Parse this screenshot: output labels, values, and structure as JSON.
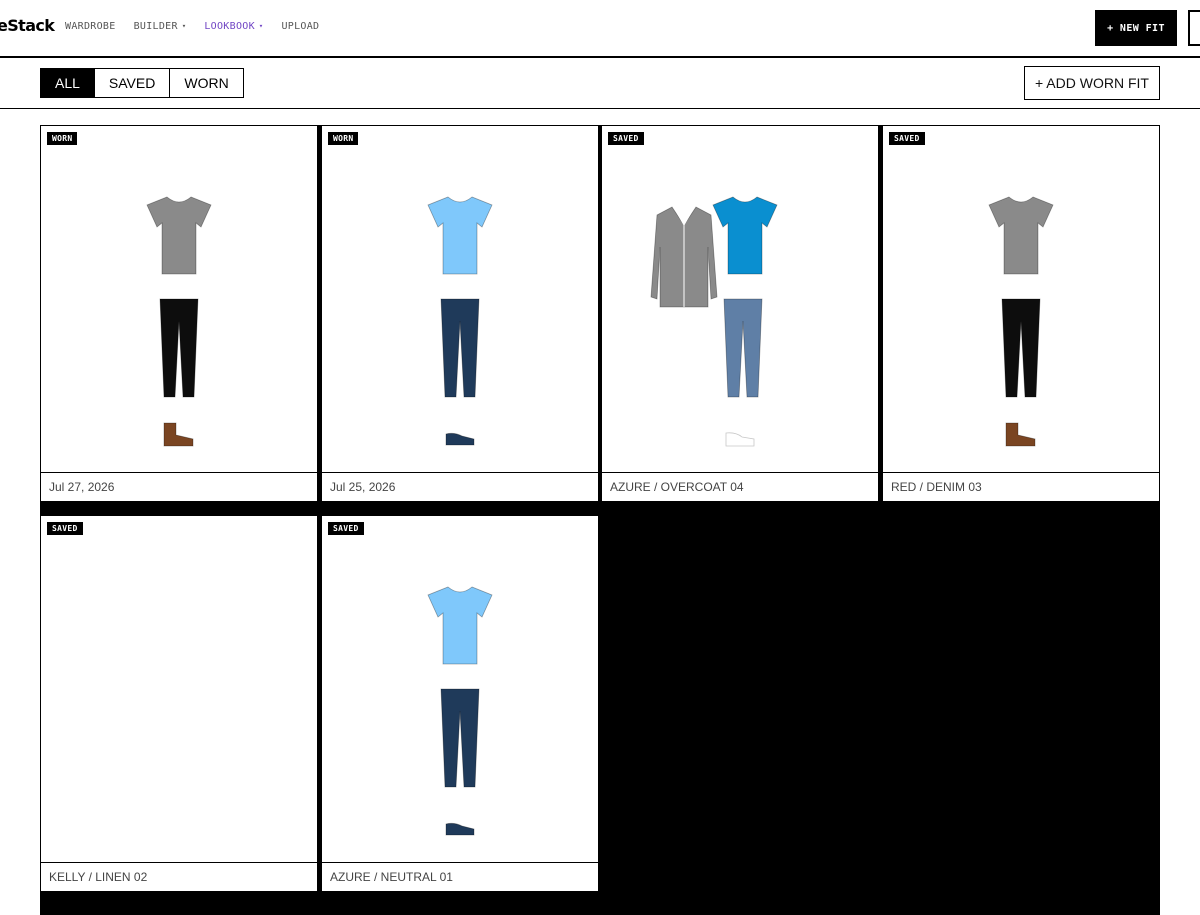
{
  "header": {
    "logo_text": "eStack",
    "nav": [
      {
        "label": "WARDROBE",
        "caret": ""
      },
      {
        "label": "BUILDER",
        "caret": "▾"
      },
      {
        "label": "LOOKBOOK",
        "caret": "▾"
      },
      {
        "label": "UPLOAD",
        "caret": ""
      }
    ],
    "active_nav": "LOOKBOOK",
    "new_fit_label": "+ NEW FIT"
  },
  "filters": {
    "tabs": [
      "ALL",
      "SAVED",
      "WORN"
    ],
    "active_tab": "ALL",
    "add_worn_label": "+ ADD WORN FIT"
  },
  "colors": {
    "accent_nav": "#7045c4",
    "tee_grey": "#8a8a8a",
    "tee_light_blue": "#7fc8fb",
    "tee_azure": "#0a8fd0",
    "pants_black": "#0d0d0d",
    "pants_navy": "#1f3a5a",
    "pants_denim": "#5f7fa6",
    "coat_grey": "#8a8a8a",
    "boot_brown": "#7a4522",
    "sneaker_white": "#ffffff"
  },
  "cards": [
    {
      "badge": "WORN",
      "footer": "Jul 27, 2026",
      "items": [
        {
          "type": "tee",
          "color": "#8a8a8a"
        },
        {
          "type": "pants",
          "color": "#0d0d0d"
        },
        {
          "type": "boot",
          "color": "#7a4522"
        }
      ]
    },
    {
      "badge": "WORN",
      "footer": "Jul 25, 2026",
      "items": [
        {
          "type": "tee",
          "color": "#7fc8fb"
        },
        {
          "type": "pants",
          "color": "#1f3a5a"
        },
        {
          "type": "shoe",
          "color": "#1f3a5a"
        }
      ]
    },
    {
      "badge": "SAVED",
      "footer": "AZURE / OVERCOAT 04",
      "items": [
        {
          "type": "coat",
          "color": "#8a8a8a"
        },
        {
          "type": "tee",
          "color": "#0a8fd0"
        },
        {
          "type": "pants",
          "color": "#5f7fa6"
        },
        {
          "type": "sneaker",
          "color": "#ffffff"
        }
      ]
    },
    {
      "badge": "SAVED",
      "footer": "RED / DENIM 03",
      "items": [
        {
          "type": "tee",
          "color": "#8a8a8a"
        },
        {
          "type": "pants",
          "color": "#0d0d0d"
        },
        {
          "type": "boot",
          "color": "#7a4522"
        }
      ]
    },
    {
      "badge": "SAVED",
      "footer": "KELLY / LINEN 02",
      "items": []
    },
    {
      "badge": "SAVED",
      "footer": "AZURE / NEUTRAL 01",
      "items": [
        {
          "type": "tee",
          "color": "#7fc8fb"
        },
        {
          "type": "pants",
          "color": "#1f3a5a"
        },
        {
          "type": "shoe",
          "color": "#1f3a5a"
        }
      ]
    }
  ]
}
